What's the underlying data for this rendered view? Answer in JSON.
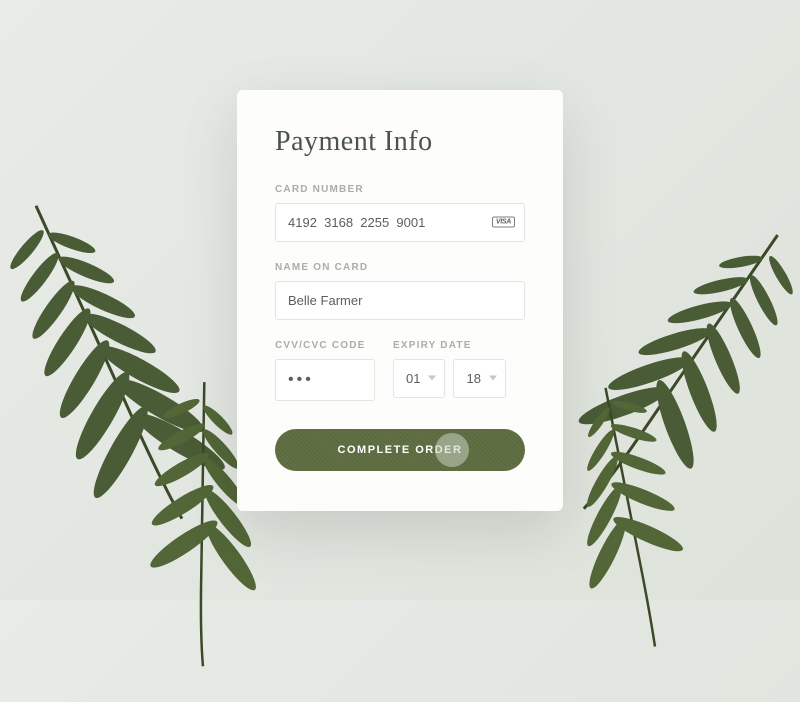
{
  "title": "Payment Info",
  "fields": {
    "cardNumber": {
      "label": "CARD NUMBER",
      "value": "4192  3168  2255  9001",
      "cardType": "VISA"
    },
    "nameOnCard": {
      "label": "NAME ON CARD",
      "value": "Belle Farmer"
    },
    "cvv": {
      "label": "CVV/CVC CODE",
      "value": "•••"
    },
    "expiry": {
      "label": "EXPIRY DATE",
      "month": "01",
      "year": "18"
    }
  },
  "submitLabel": "COMPLETE ORDER",
  "colors": {
    "accent": "#5c6b3f"
  }
}
